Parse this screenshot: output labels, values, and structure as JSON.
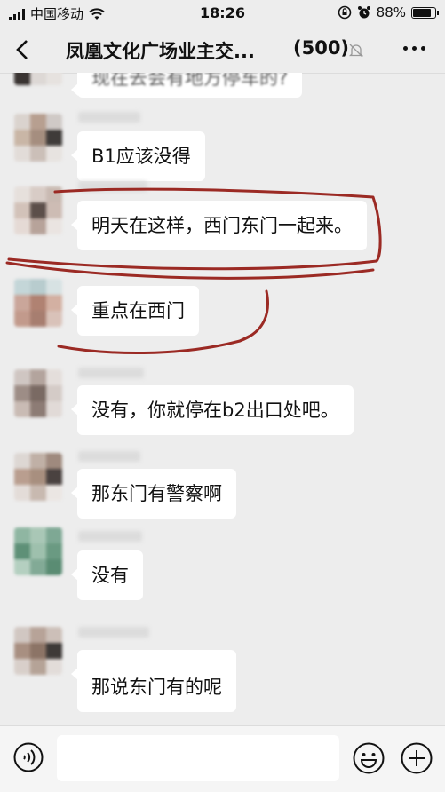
{
  "status_bar": {
    "carrier": "中国移动",
    "time": "18:26",
    "battery": "88%",
    "battery_level": 0.88
  },
  "nav": {
    "title": "凤凰文化广场业主交...",
    "count": "(500)",
    "back_icon": "chevron-left-icon",
    "mute_icon": "mute-bell-icon",
    "more_icon": "ellipsis-icon"
  },
  "messages": [
    {
      "text": "现在去会有地方停车的?",
      "partial": true
    },
    {
      "text": "B1应该没得"
    },
    {
      "text": "明天在这样，西门东门一起来。"
    },
    {
      "text": "重点在西门"
    },
    {
      "text": "没有，你就停在b2出口处吧。"
    },
    {
      "text": "那东门有警察啊"
    },
    {
      "text": "没有"
    },
    {
      "text": "那说东门有的呢"
    }
  ],
  "annotation_color": "#9b2a24",
  "input_bar": {
    "placeholder": "",
    "voice_icon": "voice-icon",
    "emoji_icon": "emoji-icon",
    "plus_icon": "plus-circle-icon"
  }
}
